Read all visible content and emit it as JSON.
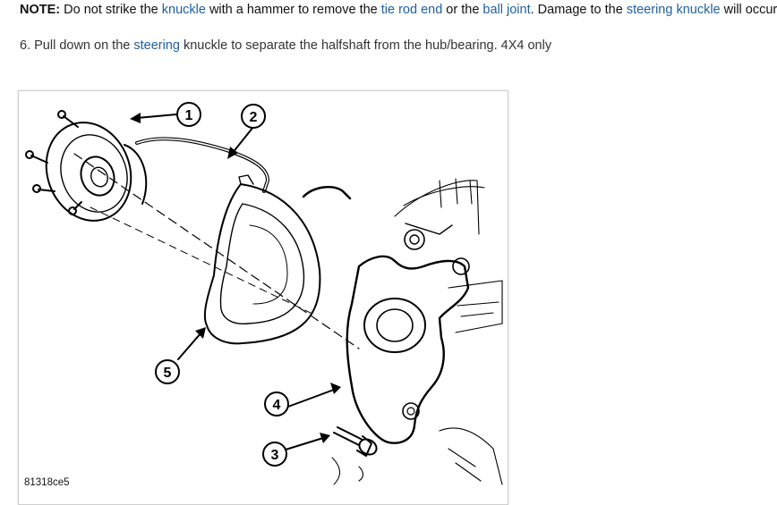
{
  "note": {
    "label": "NOTE:",
    "t1": " Do not strike the ",
    "k1": "knuckle",
    "t2": " with a hammer to remove the ",
    "k2": "tie rod end",
    "t3": " or the ",
    "k3": "ball joint",
    "t4": ". Damage to the ",
    "k4": "steering knuckle",
    "t5": " will occur."
  },
  "step": {
    "t1": "6. Pull down on the ",
    "k1": "steering",
    "t2": " knuckle to separate the halfshaft from the hub/bearing. 4X4 only"
  },
  "figure": {
    "id_label": "81318ce5",
    "callouts": [
      "1",
      "2",
      "3",
      "4",
      "5"
    ]
  },
  "colors": {
    "link": "#1f5f9e",
    "text": "#333333",
    "line_art": "#000000"
  }
}
